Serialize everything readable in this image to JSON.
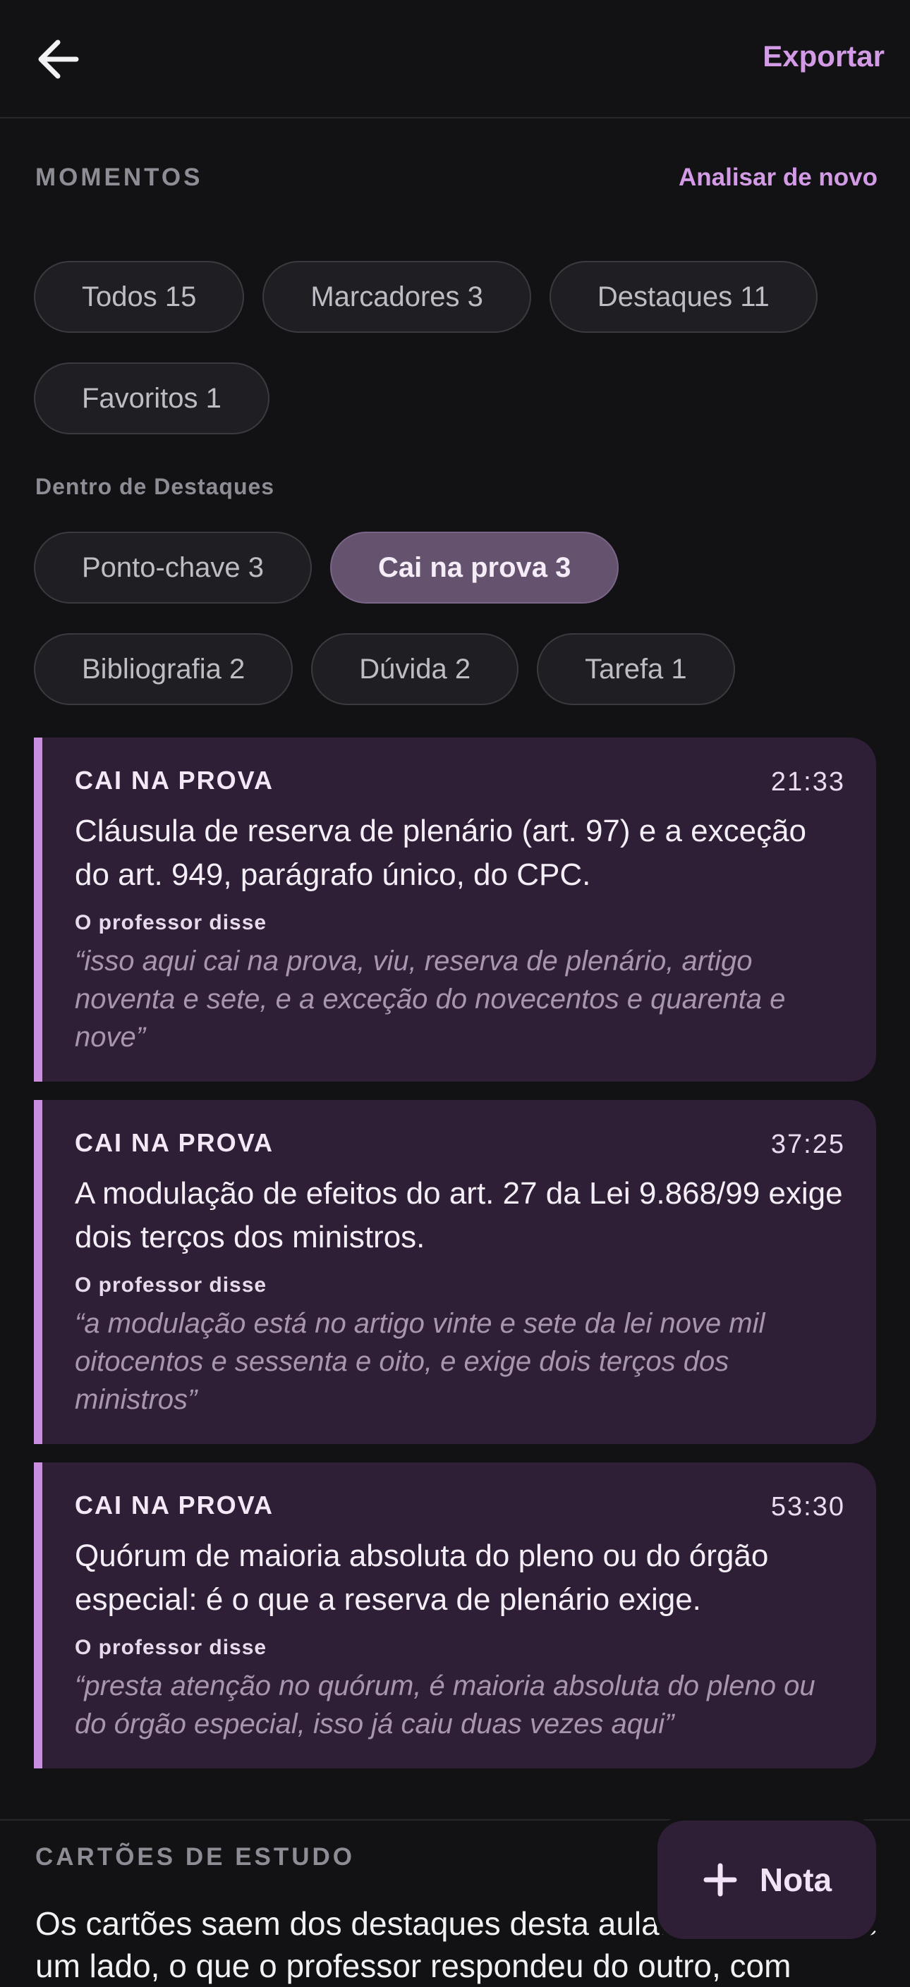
{
  "header": {
    "export_label": "Exportar"
  },
  "moments": {
    "section_label": "MOMENTOS",
    "reanalyze_label": "Analisar de novo",
    "filters": [
      {
        "label": "Todos 15"
      },
      {
        "label": "Marcadores 3"
      },
      {
        "label": "Destaques 11"
      },
      {
        "label": "Favoritos 1"
      }
    ],
    "sub_label": "Dentro de Destaques",
    "subfilters": [
      {
        "label": "Ponto-chave 3",
        "active": false
      },
      {
        "label": "Cai na prova 3",
        "active": true
      },
      {
        "label": "Bibliografia 2",
        "active": false
      },
      {
        "label": "Dúvida 2",
        "active": false
      },
      {
        "label": "Tarefa 1",
        "active": false
      }
    ],
    "cards": [
      {
        "tag": "CAI NA PROVA",
        "time": "21:33",
        "title": "Cláusula de reserva de plenário (art. 97) e a exceção do art. 949, parágrafo único, do CPC.",
        "said_label": "O professor disse",
        "quote": "“isso aqui cai na prova, viu, reserva de plenário, artigo noventa e sete, e a exceção do novecentos e quarenta e nove”"
      },
      {
        "tag": "CAI NA PROVA",
        "time": "37:25",
        "title": "A modulação de efeitos do art. 27 da Lei 9.868/99 exige dois terços dos ministros.",
        "said_label": "O professor disse",
        "quote": "“a modulação está no artigo vinte e sete da lei nove mil oitocentos e sessenta e oito, e exige dois terços dos ministros”"
      },
      {
        "tag": "CAI NA PROVA",
        "time": "53:30",
        "title": "Quórum de maioria absoluta do pleno ou do órgão especial: é o que a reserva de plenário exige.",
        "said_label": "O professor disse",
        "quote": "“presta atenção no quórum, é maioria absoluta do pleno ou do órgão especial, isso já caiu duas vezes aqui”"
      }
    ]
  },
  "study": {
    "section_label": "CARTÕES DE ESTUDO",
    "text": "Os cartões saem dos destaques desta aula: a pergunta de um lado, o que o professor respondeu do outro, com"
  },
  "fab": {
    "label": "Nota",
    "icon": "plus-icon"
  },
  "colors": {
    "accent": "#d39be6",
    "card_bg": "#2e1f36",
    "card_bar": "#c98ee0",
    "background": "#121214"
  }
}
